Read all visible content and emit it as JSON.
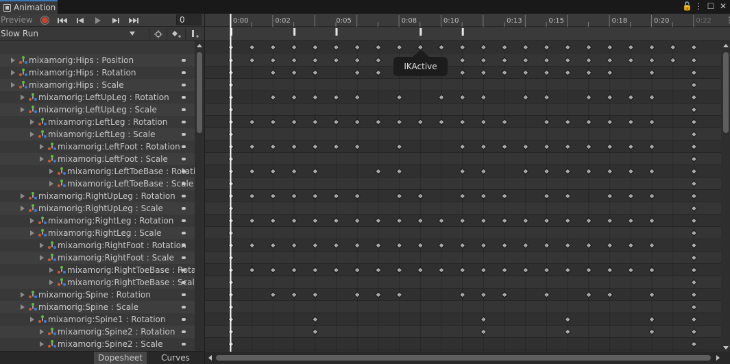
{
  "window": {
    "tab_title": "Animation"
  },
  "toolbar": {
    "preview_label": "Preview",
    "record_icon": "record-icon",
    "first_key_icon": "first-key-icon",
    "prev_key_icon": "prev-key-icon",
    "play_icon": "play-icon",
    "next_key_icon": "next-key-icon",
    "last_key_icon": "last-key-icon",
    "frame_value": "0"
  },
  "clipbar": {
    "clip_name": "Slow Run",
    "add_keyframe_icon": "add-keyframe-icon",
    "add_event_icon": "add-event-icon"
  },
  "properties": [
    {
      "label": "mixamorig:Hips : Position",
      "indent": 0
    },
    {
      "label": "mixamorig:Hips : Rotation",
      "indent": 0
    },
    {
      "label": "mixamorig:Hips : Scale",
      "indent": 0
    },
    {
      "label": "mixamorig:LeftUpLeg : Rotation",
      "indent": 1
    },
    {
      "label": "mixamorig:LeftUpLeg : Scale",
      "indent": 1
    },
    {
      "label": "mixamorig:LeftLeg : Rotation",
      "indent": 2
    },
    {
      "label": "mixamorig:LeftLeg : Scale",
      "indent": 2
    },
    {
      "label": "mixamorig:LeftFoot : Rotation",
      "indent": 3
    },
    {
      "label": "mixamorig:LeftFoot : Scale",
      "indent": 3
    },
    {
      "label": "mixamorig:LeftToeBase : Rotation",
      "indent": 4
    },
    {
      "label": "mixamorig:LeftToeBase : Scale",
      "indent": 4
    },
    {
      "label": "mixamorig:RightUpLeg : Rotation",
      "indent": 1
    },
    {
      "label": "mixamorig:RightUpLeg : Scale",
      "indent": 1
    },
    {
      "label": "mixamorig:RightLeg : Rotation",
      "indent": 2
    },
    {
      "label": "mixamorig:RightLeg : Scale",
      "indent": 2
    },
    {
      "label": "mixamorig:RightFoot : Rotation",
      "indent": 3
    },
    {
      "label": "mixamorig:RightFoot : Scale",
      "indent": 3
    },
    {
      "label": "mixamorig:RightToeBase : Rotation",
      "indent": 4
    },
    {
      "label": "mixamorig:RightToeBase : Scale",
      "indent": 4
    },
    {
      "label": "mixamorig:Spine : Rotation",
      "indent": 1
    },
    {
      "label": "mixamorig:Spine : Scale",
      "indent": 1
    },
    {
      "label": "mixamorig:Spine1 : Rotation",
      "indent": 2
    },
    {
      "label": "mixamorig:Spine2 : Rotation",
      "indent": 3
    },
    {
      "label": "mixamorig:Spine2 : Scale",
      "indent": 3
    }
  ],
  "timeline": {
    "tick_labels": [
      "0:00",
      "0:02",
      "0:05",
      "0:08",
      "0:10",
      "0:13",
      "0:15",
      "0:18",
      "0:20",
      "0:22"
    ],
    "end_label": "0:22",
    "event_frames": [
      0,
      3,
      5,
      9,
      11
    ],
    "tooltip": "IKActive",
    "summary_keys": [
      0,
      1,
      2,
      3,
      4,
      5,
      6,
      7,
      8,
      9,
      10,
      11,
      12,
      13,
      14,
      15,
      16,
      17,
      18,
      19,
      20,
      21,
      22
    ],
    "row_keys": [
      [
        0,
        1,
        2,
        3,
        4,
        5,
        6,
        7,
        8,
        9,
        10,
        11,
        12,
        13,
        14,
        15,
        16,
        17,
        18,
        19,
        20,
        21,
        22
      ],
      [
        0,
        2,
        3,
        4,
        6,
        7,
        8,
        11,
        12,
        13,
        14,
        15,
        16,
        17,
        18,
        20,
        22
      ],
      [
        0,
        22
      ],
      [
        0,
        2,
        3,
        4,
        5,
        6,
        8,
        10,
        11,
        12,
        14,
        15,
        17,
        18,
        19,
        20,
        22
      ],
      [
        0,
        22
      ],
      [
        0,
        1,
        2,
        3,
        4,
        5,
        6,
        7,
        8,
        9,
        10,
        11,
        12,
        13,
        15,
        16,
        17,
        18,
        19,
        20,
        22
      ],
      [
        0,
        22
      ],
      [
        0,
        1,
        2,
        3,
        4,
        5,
        6,
        8,
        11,
        12,
        13,
        14,
        15,
        16,
        17,
        18,
        19,
        20,
        22
      ],
      [
        0,
        22
      ],
      [
        0,
        1,
        2,
        3,
        4,
        7,
        8,
        11,
        12,
        14,
        15,
        16,
        17,
        18,
        19,
        20,
        22
      ],
      [
        0,
        22
      ],
      [
        0,
        1,
        2,
        3,
        4,
        5,
        6,
        8,
        9,
        11,
        12,
        13,
        15,
        16,
        18,
        19,
        20,
        22
      ],
      [
        0,
        22
      ],
      [
        0,
        1,
        2,
        3,
        4,
        5,
        6,
        7,
        8,
        9,
        10,
        11,
        12,
        13,
        14,
        15,
        16,
        17,
        18,
        19,
        20,
        22
      ],
      [
        0,
        22
      ],
      [
        0,
        1,
        2,
        3,
        4,
        5,
        6,
        7,
        8,
        9,
        10,
        11,
        12,
        13,
        14,
        15,
        16,
        17,
        18,
        19,
        20,
        22
      ],
      [
        0,
        22
      ],
      [
        0,
        1,
        2,
        3,
        4,
        5,
        6,
        7,
        8,
        9,
        10,
        11,
        12,
        13,
        14,
        15,
        16,
        17,
        18,
        19,
        20,
        22
      ],
      [
        0,
        22
      ],
      [
        0,
        2,
        3,
        4,
        6,
        7,
        8,
        11,
        12,
        13,
        15,
        17,
        18,
        20,
        22
      ],
      [
        0,
        22
      ],
      [
        0,
        4,
        12,
        16,
        20,
        22
      ],
      [
        0,
        4,
        12,
        16,
        20,
        22
      ],
      [
        0,
        22
      ]
    ]
  },
  "bottom_tabs": {
    "dopesheet": "Dopesheet",
    "curves": "Curves"
  },
  "colors": {
    "accent": "#3a79bb",
    "playhead": "#ffffff",
    "keyframe": "#b4b4b4",
    "tooltip_bg": "#1c1c1c"
  }
}
